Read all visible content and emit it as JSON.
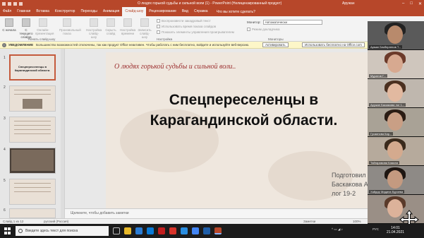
{
  "window": {
    "title": "О людях горькой судьбы и сильной воли (1) - PowerPoint (Нелицензированный продукт)",
    "user": "Аружан",
    "minimize": "–",
    "maximize": "□",
    "close": "✕"
  },
  "tabs": [
    "Файл",
    "Главная",
    "Вставка",
    "Конструктор",
    "Переходы",
    "Анимация",
    "Слайд-шоу",
    "Рецензирование",
    "Вид",
    "Справка"
  ],
  "active_tab": "Слайд-шоу",
  "tell_me": "Что вы хотите сделать?",
  "ribbon": {
    "buttons": [
      {
        "label": "С начала",
        "dim": false
      },
      {
        "label": "С текущего слайда",
        "dim": false
      },
      {
        "label": "Онлайн-презентация",
        "dim": true
      },
      {
        "label": "Произвольный показ",
        "dim": true
      },
      {
        "label": "Настройка слайд-шоу",
        "dim": true
      },
      {
        "label": "Скрыть слайд",
        "dim": true
      },
      {
        "label": "Настройка времени",
        "dim": true
      },
      {
        "label": "Записать слайд-шоу",
        "dim": true
      }
    ],
    "checkboxes": [
      "Воспроизвести закадровый текст",
      "Использовать время показа слайдов",
      "Показать элементы управления проигрывателем"
    ],
    "monitor_label": "Монитор:",
    "monitor_value": "Автоматически",
    "presenter_view": "Режим докладчика",
    "groups": [
      "Начать слайд-шоу",
      "Настройка",
      "Мониторы"
    ]
  },
  "notification": {
    "label": "УВЕДОМЛЕНИЕ",
    "text": "Большинство возможностей отключены, так как продукт Office неактивен. Чтобы работать с ним бесплатно, войдите и используйте веб-версию.",
    "activate": "Активировать",
    "free": "Использовать бесплатно на Office.com"
  },
  "thumbnails": [
    {
      "num": "1",
      "title": "Спецпереселенцы в Карагандинской области."
    },
    {
      "num": "2"
    },
    {
      "num": "3"
    },
    {
      "num": "4"
    },
    {
      "num": "5"
    },
    {
      "num": "6"
    }
  ],
  "slide": {
    "subtitle": "О людях горькой судьбы и сильной воли..",
    "title": "Спецпереселенцы в Карагандинской области.",
    "author_lines": [
      "Подготовил",
      "Баскакова Ар",
      "лог 19-2"
    ]
  },
  "notes_placeholder": "Щелкните, чтобы добавить заметки",
  "status": {
    "slide": "Слайд 1 из 12",
    "language": "русский (Россия)",
    "notes": "Заметки",
    "zoom": "100%"
  },
  "participants": [
    {
      "name": "Арман Бекбергенов Т..."
    },
    {
      "name": "Муратов Г..."
    },
    {
      "name": "Аружан Баскакова лог 1..."
    },
    {
      "name": "Гусаинова Кар..."
    },
    {
      "name": "Тайгарамова Камила"
    },
    {
      "name": "Хайдор Мадина Буриева"
    },
    {
      "name": ""
    }
  ],
  "taskbar": {
    "search_placeholder": "Введите здесь текст для поиска",
    "tray_lang": "РУС",
    "time": "14:01",
    "date": "21.04.2021"
  }
}
